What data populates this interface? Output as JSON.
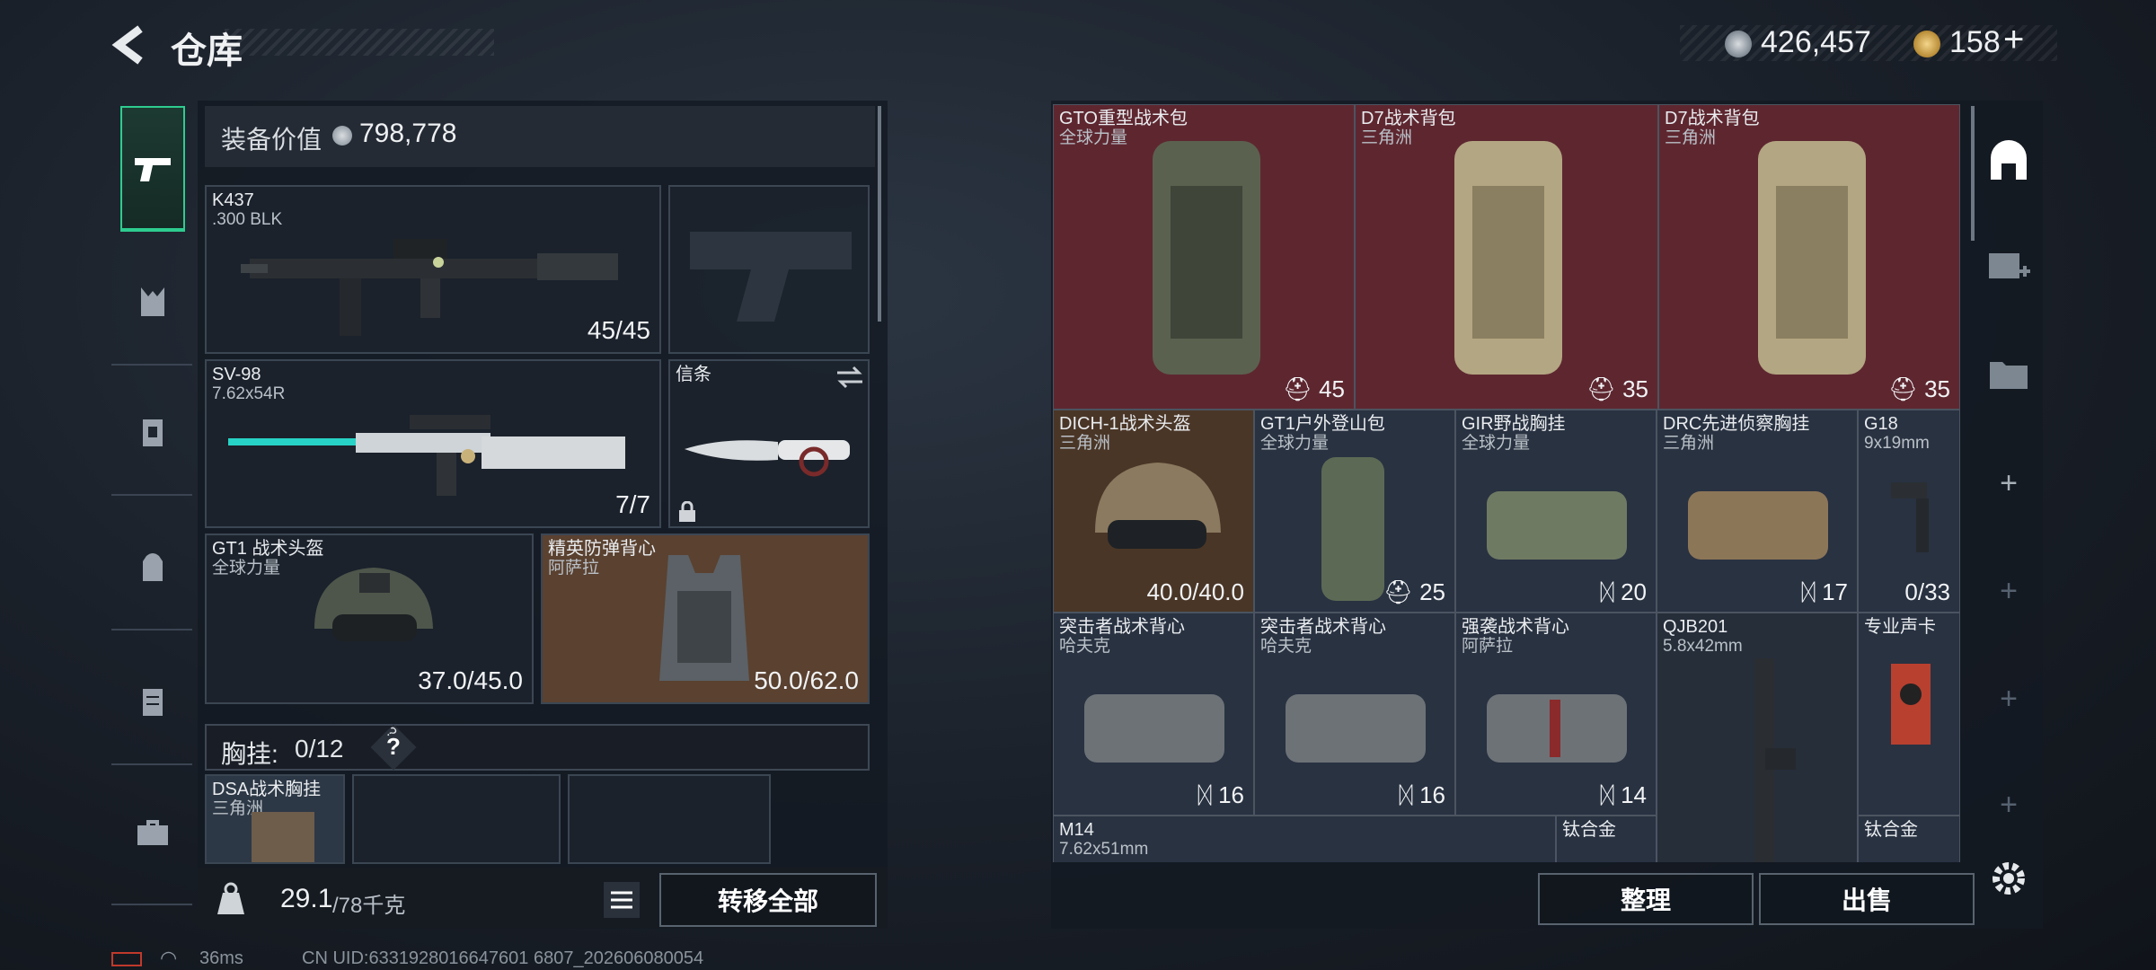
{
  "header": {
    "title": "仓库",
    "currency1": "426,457",
    "currency2": "158",
    "plus": "+"
  },
  "equip": {
    "label": "装备价值",
    "value": "798,778"
  },
  "weapons": [
    {
      "name": "K437",
      "sub": ".300 BLK",
      "value": "45/45"
    },
    {
      "name": "SV-98",
      "sub": "7.62x54R",
      "value": "7/7"
    }
  ],
  "melee": {
    "name": "信条"
  },
  "helmet": {
    "name": "GT1 战术头盔",
    "sub": "全球力量",
    "value": "37.0/45.0"
  },
  "armor": {
    "name": "精英防弹背心",
    "sub": "阿萨拉",
    "value": "50.0/62.0"
  },
  "chest": {
    "label": "胸挂:",
    "count": "0/12",
    "help": "?",
    "item_name": "DSA战术胸挂",
    "item_sub": "三角洲"
  },
  "bottom": {
    "weight": "29.1",
    "weight_max": "/78千克",
    "transfer": "转移全部"
  },
  "status": {
    "ping": "36ms",
    "uid": "CN UID:6331928016647601 6807_202606080054"
  },
  "stash": {
    "row1": [
      {
        "name": "GTO重型战术包",
        "sub": "全球力量",
        "count": "45"
      },
      {
        "name": "D7战术背包",
        "sub": "三角洲",
        "count": "35"
      },
      {
        "name": "D7战术背包",
        "sub": "三角洲",
        "count": "35"
      }
    ],
    "row2": [
      {
        "name": "DICH-1战术头盔",
        "sub": "三角洲",
        "count": "40.0/40.0"
      },
      {
        "name": "GT1户外登山包",
        "sub": "全球力量",
        "count": "25"
      },
      {
        "name": "GIR野战胸挂",
        "sub": "全球力量",
        "count": "20"
      },
      {
        "name": "DRC先进侦察胸挂",
        "sub": "三角洲",
        "count": "17"
      },
      {
        "name": "G18",
        "sub": "9x19mm",
        "count": "0/33"
      }
    ],
    "row3": [
      {
        "name": "突击者战术背心",
        "sub": "哈夫克",
        "count": "16"
      },
      {
        "name": "突击者战术背心",
        "sub": "哈夫克",
        "count": "16"
      },
      {
        "name": "强袭战术背心",
        "sub": "阿萨拉",
        "count": "14"
      },
      {
        "name": "QJB201",
        "sub": "5.8x42mm"
      },
      {
        "name": "专业声卡"
      }
    ],
    "row4": [
      {
        "name": "M14",
        "sub": "7.62x51mm"
      },
      {
        "name": "钛合金"
      },
      {
        "name": "钛合金"
      }
    ]
  },
  "actions": {
    "sort": "整理",
    "sell": "出售"
  },
  "colors": {
    "accent": "#2ecc8f",
    "red_cell": "#6b2a30",
    "brown_cell": "#5a4130"
  }
}
